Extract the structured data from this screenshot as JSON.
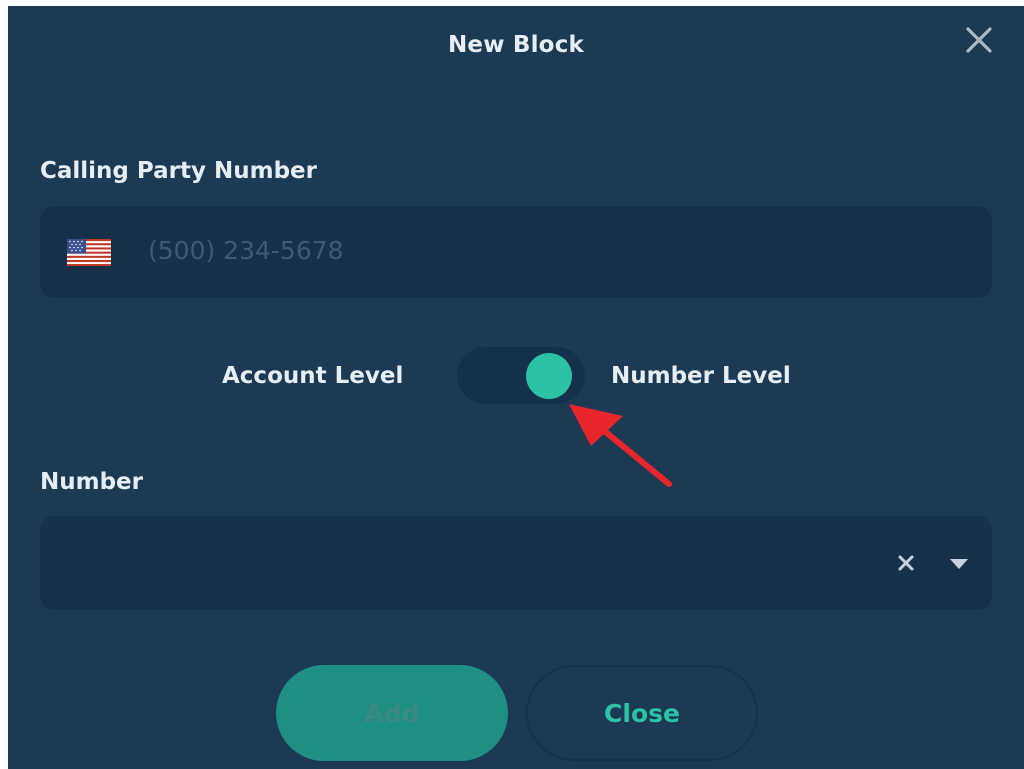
{
  "dialog": {
    "title": "New Block",
    "close_icon": "close-icon"
  },
  "calling_party": {
    "label": "Calling Party Number",
    "country_flag": "us-flag-icon",
    "placeholder": "(500) 234-5678"
  },
  "level_toggle": {
    "left_label": "Account Level",
    "right_label": "Number Level",
    "state": "Number Level",
    "accent_color": "#2cc2a4"
  },
  "number_field": {
    "label": "Number",
    "value": "",
    "clear_icon": "clear-x-icon",
    "dropdown_icon": "caret-down-icon"
  },
  "actions": {
    "add_label": "Add",
    "close_label": "Close"
  },
  "colors": {
    "background": "#1c3a54",
    "input_background": "#17314a",
    "accent": "#2cc2a4",
    "annotation_arrow": "#e8262b"
  }
}
